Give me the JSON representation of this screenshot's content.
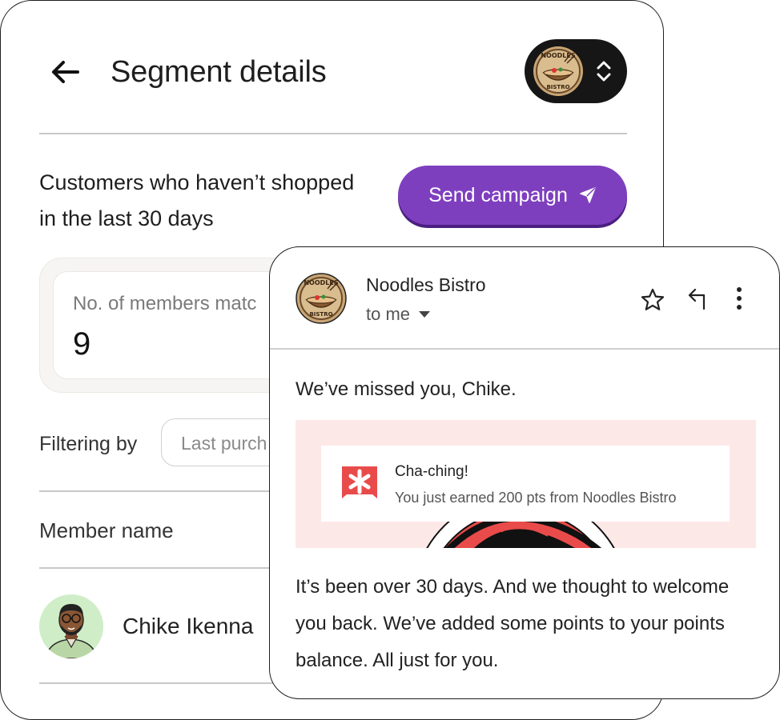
{
  "segment": {
    "title": "Segment details",
    "description": "Customers who haven’t shopped in the last 30 days",
    "send_button_label": "Send campaign",
    "members_label": "No. of members matc",
    "members_count": "9",
    "filter_label": "Filtering by",
    "filter_value": "Last purch",
    "column_header": "Member name",
    "members": [
      {
        "name": "Chike Ikenna"
      }
    ]
  },
  "email": {
    "sender": "Noodles Bistro",
    "recipient": "to me",
    "greeting": "We’ve missed you, Chike.",
    "notification_title": "Cha-ching!",
    "notification_body": "You just earned 200 pts from Noodles Bistro",
    "body": "It’s been over 30 days. And we thought to welcome you back. We’ve added some points to your points balance. All just for you."
  },
  "brand": {
    "logo_text_top": "NOODLES",
    "logo_text_bottom": "BISTRO"
  },
  "colors": {
    "accent": "#7e3fbf",
    "notification_icon": "#e94b4b",
    "banner_bg": "#fde8e8"
  },
  "icons": [
    "back-arrow-icon",
    "chevron-up-down-icon",
    "send-icon",
    "star-icon",
    "reply-icon",
    "more-vertical-icon",
    "caret-down-icon",
    "asterisk-badge-icon"
  ]
}
